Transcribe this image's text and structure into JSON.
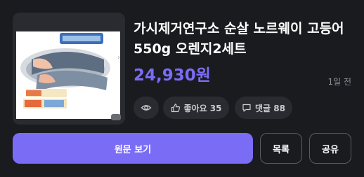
{
  "product": {
    "title": "가시제거연구소 순살 노르웨이 고등어 550g 오렌지2세트",
    "price": "24,930원",
    "posted": "1일 전"
  },
  "stats": {
    "views_icon": "eye-icon",
    "likes_label": "좋아요 35",
    "comments_label": "댓글 88"
  },
  "actions": {
    "view_original": "원문 보기",
    "list": "목록",
    "share": "공유"
  },
  "colors": {
    "accent": "#7b6cf6",
    "background": "#1a1b1f",
    "card": "#2a2b31"
  }
}
